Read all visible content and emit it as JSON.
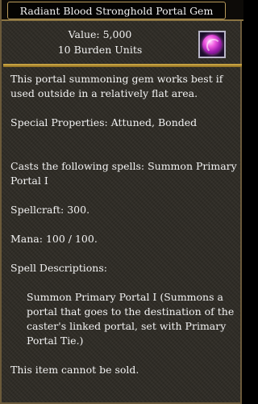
{
  "title": "Radiant Blood Stronghold Portal Gem",
  "value": "Value: 5,000",
  "burden": "10 Burden Units",
  "icon": "portal-gem-icon",
  "description": "This portal summoning gem works best if used outside in a relatively flat area.",
  "special_properties": "Special Properties: Attuned, Bonded",
  "casts": "Casts the following spells: Summon Primary Portal I",
  "spellcraft": "Spellcraft: 300.",
  "mana": "Mana: 100 / 100.",
  "spell_descriptions_heading": "Spell Descriptions:",
  "spell_description": "Summon Primary Portal I (Summons a portal that goes to the destination of the caster's linked portal, set with Primary Portal Tie.)",
  "sell_note": "This item cannot be sold."
}
